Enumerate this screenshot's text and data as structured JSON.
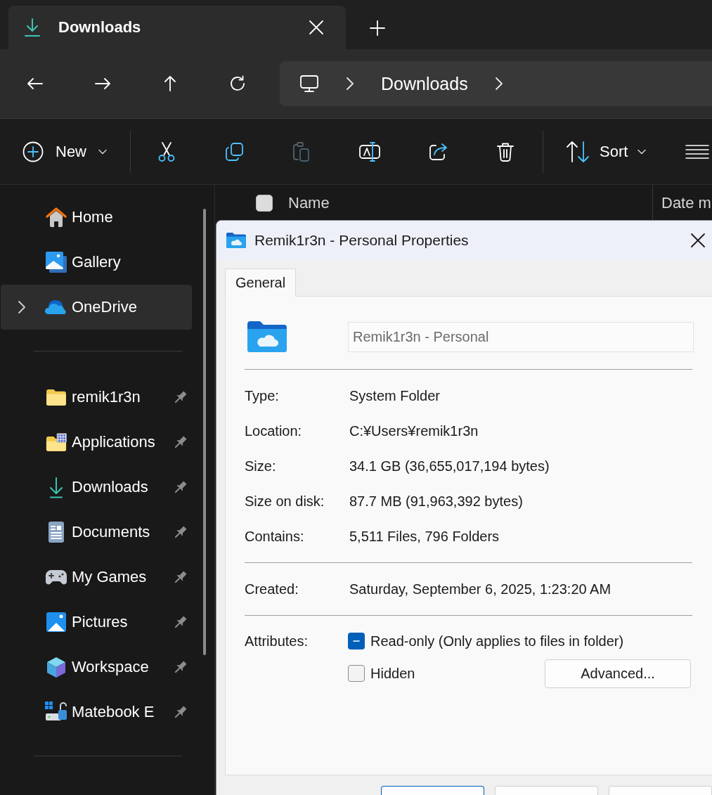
{
  "tabs": [
    {
      "label": "Downloads",
      "selected": true
    }
  ],
  "address_bar": {
    "crumbs": [
      "Downloads"
    ]
  },
  "toolbar": {
    "new_button": {
      "label": "New"
    },
    "actions": [
      {
        "disabled": false
      },
      {
        "disabled": false
      },
      {
        "disabled": true
      },
      {
        "disabled": false
      },
      {
        "disabled": false
      },
      {
        "disabled": false
      }
    ],
    "sort_button": {
      "label": "Sort"
    }
  },
  "sidebar": {
    "groups": [
      {
        "items": [
          {
            "label": "Home",
            "selected": false,
            "expandable": false
          },
          {
            "label": "Gallery",
            "selected": false,
            "expandable": false
          },
          {
            "label": "OneDrive",
            "selected": true,
            "expandable": true
          }
        ]
      },
      {
        "items": [
          {
            "label": "remik1r3n",
            "selected": false,
            "pinned": true
          },
          {
            "label": "Applications",
            "selected": false,
            "pinned": true
          },
          {
            "label": "Downloads",
            "selected": false,
            "pinned": true
          },
          {
            "label": "Documents",
            "selected": false,
            "pinned": true
          },
          {
            "label": "My Games",
            "selected": false,
            "pinned": true
          },
          {
            "label": "Pictures",
            "selected": false,
            "pinned": true
          },
          {
            "label": "Workspace",
            "selected": false,
            "pinned": true
          },
          {
            "label": "Matebook E",
            "selected": false,
            "pinned": true
          }
        ]
      }
    ]
  },
  "file_list": {
    "select_all": {
      "checked": false
    },
    "columns": [
      "Name",
      "Date m"
    ]
  },
  "dialog": {
    "title": "Remik1r3n - Personal Properties",
    "tabs": [
      {
        "label": "General",
        "selected": true
      }
    ],
    "name_field": {
      "value": "Remik1r3n - Personal",
      "disabled": true
    },
    "property_groups": [
      {
        "rows": [
          {
            "label": "Type:",
            "value": "System Folder"
          },
          {
            "label": "Location:",
            "value": "C:¥Users¥remik1r3n"
          },
          {
            "label": "Size:",
            "value": "34.1 GB (36,655,017,194 bytes)"
          },
          {
            "label": "Size on disk:",
            "value": "87.7 MB (91,963,392 bytes)"
          },
          {
            "label": "Contains:",
            "value": "5,511 Files, 796 Folders"
          }
        ]
      },
      {
        "rows": [
          {
            "label": "Created:",
            "value": "Saturday, September 6, 2025, 1:23:20 AM"
          }
        ]
      }
    ],
    "attributes": {
      "label": "Attributes:",
      "options": [
        {
          "label": "Read-only (Only applies to files in folder)",
          "checked": false,
          "indeterminate": true
        },
        {
          "label": "Hidden",
          "checked": false,
          "indeterminate": false
        }
      ]
    },
    "advanced_button": {
      "label": "Advanced..."
    },
    "footer_buttons": [
      {
        "default": true
      },
      {
        "default": false
      },
      {
        "default": false
      }
    ]
  }
}
